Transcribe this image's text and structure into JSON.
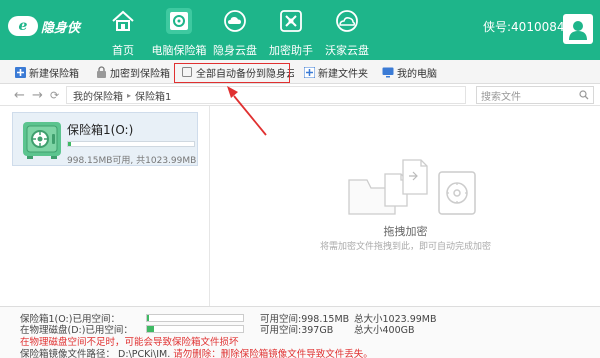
{
  "header": {
    "logo_text": "隐身侠",
    "logo_mark": "e",
    "user_id": "侠号:40100844",
    "nav": [
      {
        "label": "首页",
        "icon": "home-icon"
      },
      {
        "label": "电脑保险箱",
        "icon": "safe-icon"
      },
      {
        "label": "隐身云盘",
        "icon": "cloud-icon"
      },
      {
        "label": "加密助手",
        "icon": "tools-icon"
      },
      {
        "label": "沃家云盘",
        "icon": "cloud-house-icon"
      }
    ],
    "active_nav": "电脑保险箱"
  },
  "toolbar": {
    "new_vault": "新建保险箱",
    "encrypt_to_vault": "加密到保险箱",
    "auto_backup": "全部自动备份到隐身云盘",
    "new_folder": "新建文件夹",
    "my_computer": "我的电脑"
  },
  "addressbar": {
    "crumb_root": "我的保险箱",
    "crumb_sep": "▸",
    "crumb_current": "保险箱1",
    "search_placeholder": "搜索文件"
  },
  "vault": {
    "name": "保险箱1(O:)",
    "size_text": "998.15MB可用, 共1023.99MB",
    "usage_fraction": 0.025
  },
  "main": {
    "drop_title": "拖拽加密",
    "drop_hint": "将需加密文件拖拽到此，即可自动完成加密"
  },
  "status": {
    "vault_used_label": "保险箱1(O:)已用空间：",
    "vault_used_fraction": 0.025,
    "vault_avail": "可用空间:998.15MB",
    "vault_total": "总大小1023.99MB",
    "disk_used_label": "在物理磁盘(D:)已用空间：",
    "disk_used_fraction": 0.07,
    "disk_avail": "可用空间:397GB",
    "disk_total": "总大小400GB",
    "warning": "在物理磁盘空间不足时，可能会导致保险箱文件损坏",
    "image_path_label": "保险箱镜像文件路径：",
    "image_path": "D:\\PCKi\\IM.",
    "delete_hint": "请勿删除：删除保险箱镜像文件导致文件丢失。"
  },
  "colors": {
    "brand_green": "#1eb58a",
    "highlight_red": "#e03030",
    "progress_green": "#3fb964"
  }
}
